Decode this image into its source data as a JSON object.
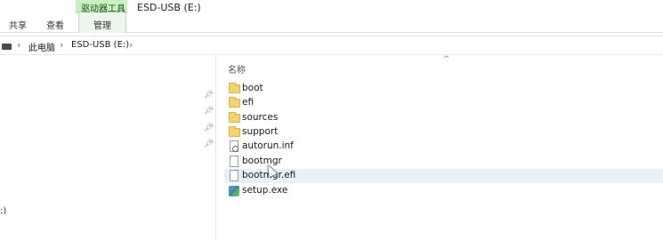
{
  "window": {
    "title": "ESD-USB (E:)"
  },
  "ribbon": {
    "context_group": "驱动器工具",
    "tabs": [
      {
        "label": "共享"
      },
      {
        "label": "查看"
      },
      {
        "label": "管理"
      }
    ]
  },
  "address_bar": {
    "icon": "pc-icon",
    "crumbs": [
      "此电脑",
      "ESD-USB (E:)"
    ],
    "separator": "›"
  },
  "nav_pane": {
    "pin_icon": "pin-icon",
    "truncated_item": ":)"
  },
  "file_list": {
    "column_name": "名称",
    "sort_indicator": "^",
    "items": [
      {
        "name": "boot",
        "icon": "folder-icon"
      },
      {
        "name": "efi",
        "icon": "folder-icon"
      },
      {
        "name": "sources",
        "icon": "folder-icon"
      },
      {
        "name": "support",
        "icon": "folder-icon"
      },
      {
        "name": "autorun.inf",
        "icon": "inf-file-icon"
      },
      {
        "name": "bootmgr",
        "icon": "file-icon"
      },
      {
        "name": "bootmgr.efi",
        "icon": "file-icon",
        "selected": true
      },
      {
        "name": "setup.exe",
        "icon": "exe-icon"
      }
    ]
  },
  "colors": {
    "context_group_bg": "#c8f2c0",
    "selection_bg": "#e5f1fb",
    "folder": "#f6d26b"
  }
}
